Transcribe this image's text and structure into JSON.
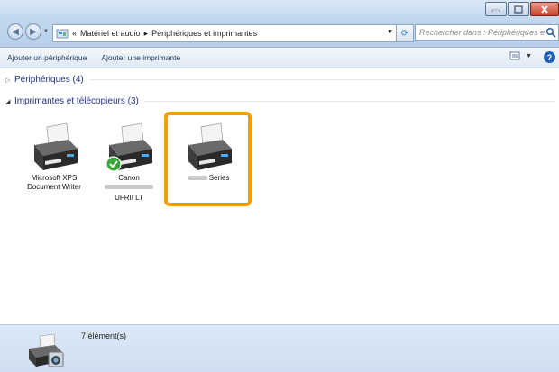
{
  "window": {
    "address": {
      "prefix": "«",
      "crumb1": "Matériel et audio",
      "sep": "▸",
      "crumb2": "Périphériques et imprimantes"
    },
    "search": {
      "placeholder": "Rechercher dans : Périphériques et i..."
    }
  },
  "toolbar": {
    "add_device": "Ajouter un périphérique",
    "add_printer": "Ajouter une imprimante"
  },
  "groups": {
    "devices": {
      "label": "Périphériques (4)",
      "expanded": false
    },
    "printers": {
      "label": "Imprimantes et télécopieurs (3)",
      "expanded": true
    }
  },
  "printers": [
    {
      "line1": "Microsoft XPS",
      "line2": "Document Writer",
      "default": false
    },
    {
      "line1": "Canon",
      "line2_blurred": true,
      "line3": "UFRII LT",
      "default": true
    },
    {
      "line1_suffix": "Series",
      "blurred_prefix": true,
      "selected": true
    }
  ],
  "status": {
    "count": "7 élément(s)"
  },
  "colors": {
    "highlight": "#f0a000",
    "group_label": "#1e3287",
    "default_badge": "#3aa53a"
  }
}
